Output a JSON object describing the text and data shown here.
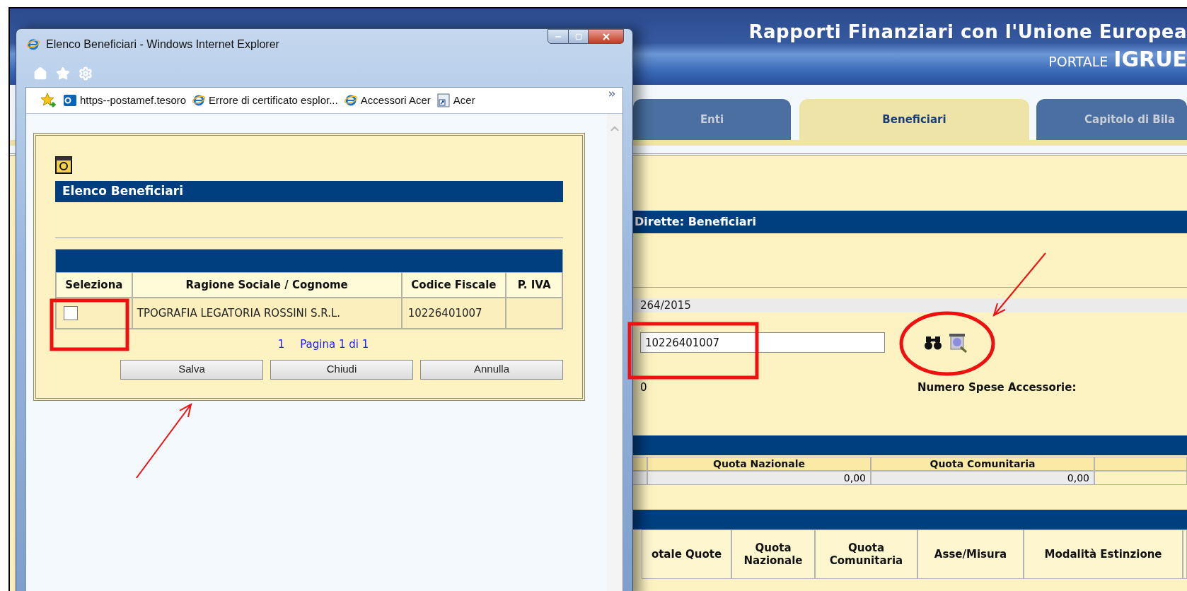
{
  "background_page": {
    "header": {
      "title": "Rapporti Finanziari con l'Unione Europea",
      "portal_prefix": "PORTALE",
      "portal_name": "IGRUE"
    },
    "tabs": [
      {
        "label": "Enti",
        "selected": false
      },
      {
        "label": "Beneficiari",
        "selected": true
      },
      {
        "label": "Capitolo di Bila",
        "selected": false
      }
    ],
    "section_title": "Dirette: Beneficiari",
    "protocol": "264/2015",
    "codice_fiscale_field": {
      "value": "10226401007"
    },
    "count": "0",
    "spese_label": "Numero Spese Accessorie:",
    "quote_table": {
      "columns": [
        "Quota Nazionale",
        "Quota Comunitaria"
      ],
      "values": [
        "0,00",
        "0,00"
      ]
    },
    "detail_table": {
      "columns": [
        "otale Quote",
        "Quota Nazionale",
        "Quota Comunitaria",
        "Asse/Misura",
        "Modalità Estinzione"
      ]
    }
  },
  "popup": {
    "title": "Elenco Beneficiari - Windows Internet Explorer",
    "favorites": [
      {
        "kind": "mail",
        "label": "https--postamef.tesoro"
      },
      {
        "kind": "browser",
        "label": "Errore di certificato esplor..."
      },
      {
        "kind": "browser",
        "label": "Accessori Acer"
      },
      {
        "kind": "shortcut",
        "label": "Acer"
      }
    ],
    "panel_title": "Elenco Beneficiari",
    "table": {
      "columns": [
        "Seleziona",
        "Ragione Sociale / Cognome",
        "Codice Fiscale",
        "P. IVA"
      ],
      "rows": [
        {
          "checked": false,
          "name": "TPOGRAFIA LEGATORIA ROSSINI S.R.L.",
          "codice_fiscale": "10226401007"
        }
      ]
    },
    "pager": {
      "page": "1",
      "label": "Pagina 1 di 1"
    },
    "buttons": [
      "Salva",
      "Chiudi",
      "Annulla"
    ]
  }
}
